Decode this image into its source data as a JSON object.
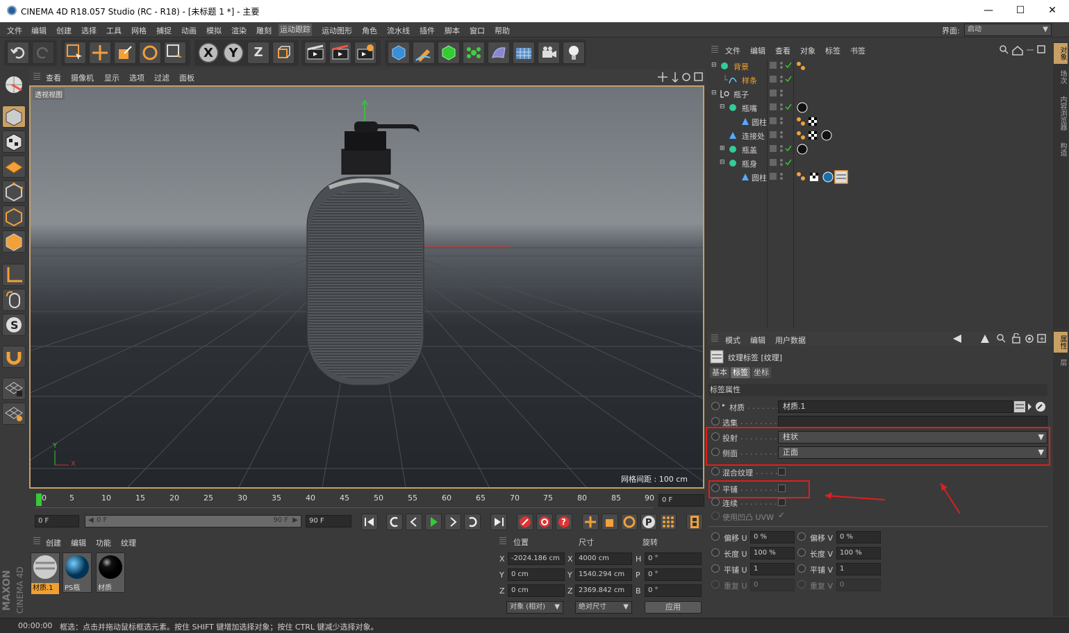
{
  "window": {
    "title": "CINEMA 4D R18.057 Studio (RC - R18) - [未标题 1 *] - 主要",
    "min": "—",
    "max": "☐",
    "close": "✕"
  },
  "menu": [
    "文件",
    "编辑",
    "创建",
    "选择",
    "工具",
    "网格",
    "捕捉",
    "动画",
    "模拟",
    "渲染",
    "雕刻",
    "运动跟踪",
    "运动图形",
    "角色",
    "流水线",
    "插件",
    "脚本",
    "窗口",
    "帮助"
  ],
  "layout": {
    "label": "界面:",
    "value": "启动"
  },
  "toolbar": {
    "x": "X",
    "y": "Y",
    "z": "Z"
  },
  "viewport": {
    "menu": [
      "查看",
      "摄像机",
      "显示",
      "选项",
      "过滤",
      "面板"
    ],
    "label": "透视视图",
    "grid": "网格间距 : 100 cm",
    "axis_y": "Y",
    "axis_x": "X"
  },
  "timeline": {
    "ticks": [
      "0",
      "5",
      "10",
      "15",
      "20",
      "25",
      "30",
      "35",
      "40",
      "45",
      "50",
      "55",
      "60",
      "65",
      "70",
      "75",
      "80",
      "85",
      "90"
    ],
    "current_frame": "0 F",
    "start": "0 F",
    "range_start": "0 F",
    "range_end": "90 F",
    "end": "90 F"
  },
  "materials": {
    "menu": [
      "创建",
      "编辑",
      "功能",
      "纹理"
    ],
    "items": [
      {
        "name": "材质.1"
      },
      {
        "name": "PS瓶"
      },
      {
        "name": "材质"
      }
    ]
  },
  "coords": {
    "headers": [
      "位置",
      "尺寸",
      "旋转"
    ],
    "rows": [
      {
        "axis": "X",
        "pos": "-2024.186 cm",
        "s_axis": "X",
        "size": "4000 cm",
        "r_axis": "H",
        "rot": "0 °"
      },
      {
        "axis": "Y",
        "pos": "0 cm",
        "s_axis": "Y",
        "size": "1540.294 cm",
        "r_axis": "P",
        "rot": "0 °"
      },
      {
        "axis": "Z",
        "pos": "0 cm",
        "s_axis": "Z",
        "size": "2369.842 cm",
        "r_axis": "B",
        "rot": "0 °"
      }
    ],
    "mode1": "对象 (相对)",
    "mode2": "绝对尺寸",
    "apply": "应用"
  },
  "status": {
    "time": "00:00:00",
    "text": "框选：点击并拖动鼠标框选元素。按住 SHIFT 键增加选择对象；按住 CTRL 键减少选择对象。"
  },
  "maxon": {
    "brand": "MAXON",
    "product": "CINEMA 4D"
  },
  "object_manager": {
    "menu": [
      "文件",
      "编辑",
      "查看",
      "对象",
      "标签",
      "书签"
    ],
    "objects": [
      {
        "name": "背景",
        "highlight": true
      },
      {
        "name": "样条",
        "highlight": true
      },
      {
        "name": "瓶子"
      },
      {
        "name": "瓶嘴"
      },
      {
        "name": "圆柱"
      },
      {
        "name": "连接处"
      },
      {
        "name": "瓶盖"
      },
      {
        "name": "瓶身"
      },
      {
        "name": "圆柱"
      }
    ]
  },
  "right_tabs_top": [
    "对象",
    "场次",
    "内容浏览器",
    "构造"
  ],
  "right_tabs_bottom": [
    "属性",
    "层"
  ],
  "attributes": {
    "menu": [
      "模式",
      "编辑",
      "用户数据"
    ],
    "header": "纹理标签 [纹理]",
    "tabs": [
      "基本",
      "标签",
      "坐标"
    ],
    "section": "标签属性",
    "material_label": "材质",
    "material_value": "材质.1",
    "selection_label": "选集",
    "projection_label": "投射",
    "projection_value": "柱状",
    "side_label": "侧面",
    "side_value": "正面",
    "mix_label": "混合纹理",
    "tile_label": "平铺",
    "seamless_label": "连续",
    "bump_label": "使用凹凸 UVW",
    "uv_rows": [
      {
        "l1": "偏移 U",
        "v1": "0 %",
        "l2": "偏移 V",
        "v2": "0 %"
      },
      {
        "l1": "长度 U",
        "v1": "100 %",
        "l2": "长度 V",
        "v2": "100 %"
      },
      {
        "l1": "平铺 U",
        "v1": "1",
        "l2": "平铺 V",
        "v2": "1"
      },
      {
        "l1": "重复 U",
        "v1": "0",
        "l2": "重复 V",
        "v2": "0"
      }
    ]
  },
  "colors": {
    "accent": "#c8a064",
    "highlight_red": "#e01f1f",
    "selected_obj": "#f0a030"
  }
}
